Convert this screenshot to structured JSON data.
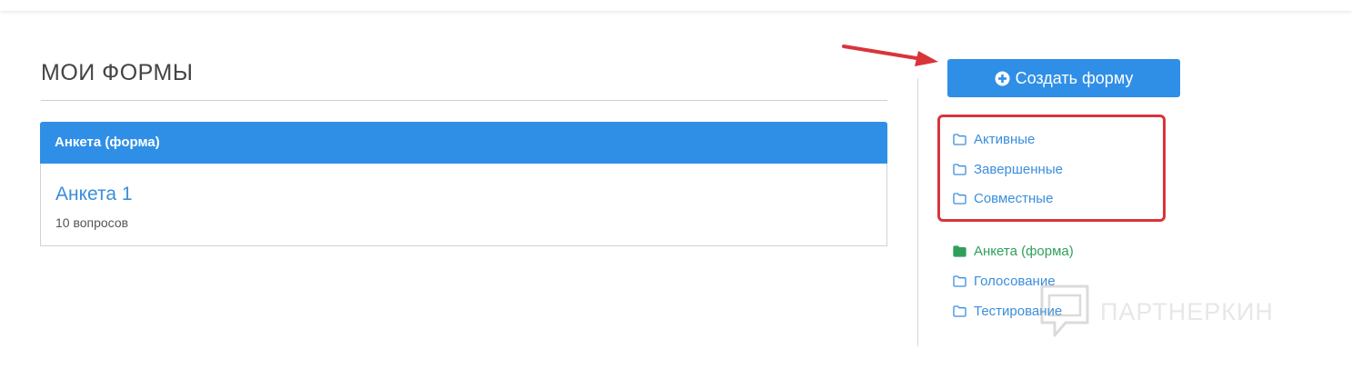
{
  "page": {
    "title": "МОИ ФОРМЫ"
  },
  "panel": {
    "header": "Анкета (форма)",
    "form_title": "Анкета 1",
    "form_meta": "10 вопросов"
  },
  "sidebar": {
    "create_button": "Создать форму",
    "status_folders": [
      {
        "label": "Активные",
        "icon": "folder-outline-icon"
      },
      {
        "label": "Завершенные",
        "icon": "folder-outline-icon"
      },
      {
        "label": "Совместные",
        "icon": "folder-outline-icon"
      }
    ],
    "type_folders": [
      {
        "label": "Анкета (форма)",
        "icon": "folder-filled-icon",
        "active": true
      },
      {
        "label": "Голосование",
        "icon": "folder-outline-icon"
      },
      {
        "label": "Тестирование",
        "icon": "folder-outline-icon"
      }
    ]
  },
  "watermark": {
    "text": "ПАРТНЕРКИН"
  },
  "colors": {
    "accent": "#2f8fe6",
    "link": "#3a8edc",
    "active_folder": "#2fa05a",
    "highlight": "#d9343a"
  }
}
